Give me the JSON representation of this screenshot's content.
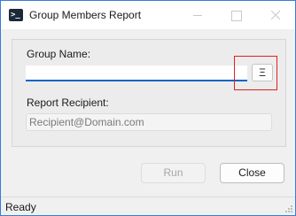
{
  "window": {
    "title": "Group Members Report",
    "icon": "powershell-icon"
  },
  "form": {
    "group_label": "Group Name:",
    "group_value": "",
    "browse_label": "Ξ",
    "recipient_label": "Report Recipient:",
    "recipient_placeholder": "Recipient@Domain.com"
  },
  "buttons": {
    "run_label": "Run",
    "close_label": "Close"
  },
  "status": {
    "text": "Ready"
  },
  "colors": {
    "accent": "#0a64c8",
    "highlight": "#e02020"
  }
}
